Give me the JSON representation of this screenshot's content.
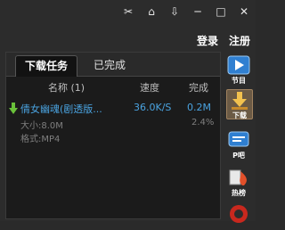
{
  "titlebar": {
    "icons": [
      "pin-icon",
      "skin-icon",
      "menu-icon",
      "minimize-icon",
      "maximize-icon",
      "close-icon"
    ],
    "glyphs": [
      "✂",
      "⌂",
      "⇩",
      "─",
      "□",
      "✕"
    ]
  },
  "auth": {
    "login": "登录",
    "register": "注册"
  },
  "tabs": [
    {
      "label": "下载任务",
      "active": true
    },
    {
      "label": "已完成",
      "active": false
    }
  ],
  "columns": {
    "name": "名称 (1)",
    "speed": "速度",
    "done": "完成"
  },
  "task": {
    "title": "倩女幽魂(剧透版...",
    "speed": "36.0K/S",
    "downloaded": "0.2M",
    "size": "大小:8.0M",
    "percent": "2.4%",
    "format": "格式:MP4"
  },
  "sidebar": {
    "items": [
      {
        "label": "节目"
      },
      {
        "label": "下载"
      },
      {
        "label": "P吧"
      },
      {
        "label": "热榜"
      },
      {
        "label": ""
      }
    ]
  },
  "colors": {
    "accent": "#4aa3e0",
    "panel": "#1b1b1b",
    "frame": "#2c2c2c",
    "download_green": "#6ac13a"
  }
}
